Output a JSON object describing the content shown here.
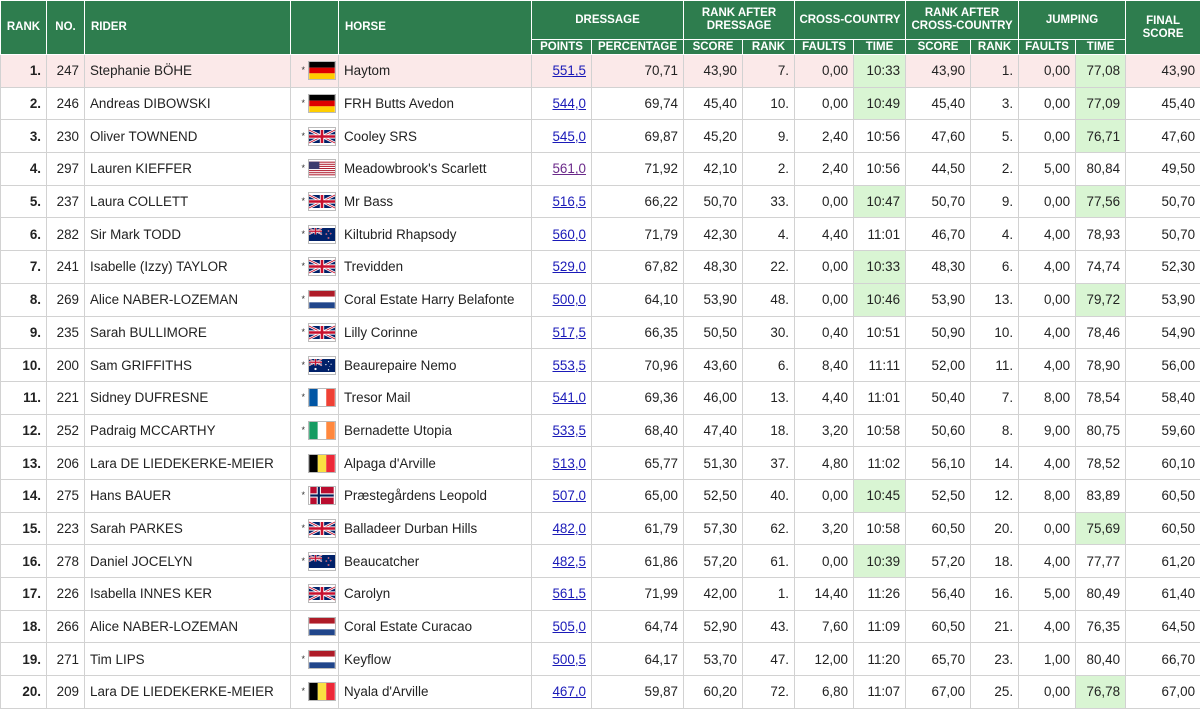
{
  "headers": {
    "rank": "RANK",
    "no": "NO.",
    "rider": "RIDER",
    "horse": "HORSE",
    "dressage": "DRESSAGE",
    "rank_after_dressage": "RANK AFTER DRESSAGE",
    "cross_country": "CROSS-COUNTRY",
    "rank_after_cross_country": "RANK AFTER CROSS-COUNTRY",
    "jumping": "JUMPING",
    "final_score": "FINAL SCORE",
    "points": "POINTS",
    "percentage": "PERCENTAGE",
    "score": "SCORE",
    "rank_sub": "RANK",
    "faults": "FAULTS",
    "time": "TIME"
  },
  "rows": [
    {
      "rank": "1.",
      "no": "247",
      "rider": "Stephanie BÖHE",
      "star": true,
      "flag": "de",
      "horse": "Haytom",
      "points": "551,5",
      "pct": "70,71",
      "rad_score": "43,90",
      "rad_rank": "7.",
      "xc_faults": "0,00",
      "xc_time": "10:33",
      "xc_time_hl": true,
      "raxc_score": "43,90",
      "raxc_rank": "1.",
      "jp_faults": "0,00",
      "jp_time": "77,08",
      "jp_time_hl": true,
      "final": "43,90"
    },
    {
      "rank": "2.",
      "no": "246",
      "rider": "Andreas DIBOWSKI",
      "star": true,
      "flag": "de",
      "horse": "FRH Butts Avedon",
      "points": "544,0",
      "pct": "69,74",
      "rad_score": "45,40",
      "rad_rank": "10.",
      "xc_faults": "0,00",
      "xc_time": "10:49",
      "xc_time_hl": true,
      "raxc_score": "45,40",
      "raxc_rank": "3.",
      "jp_faults": "0,00",
      "jp_time": "77,09",
      "jp_time_hl": true,
      "final": "45,40"
    },
    {
      "rank": "3.",
      "no": "230",
      "rider": "Oliver TOWNEND",
      "star": true,
      "flag": "gb",
      "horse": "Cooley SRS",
      "points": "545,0",
      "pct": "69,87",
      "rad_score": "45,20",
      "rad_rank": "9.",
      "xc_faults": "2,40",
      "xc_time": "10:56",
      "xc_time_hl": false,
      "raxc_score": "47,60",
      "raxc_rank": "5.",
      "jp_faults": "0,00",
      "jp_time": "76,71",
      "jp_time_hl": true,
      "final": "47,60"
    },
    {
      "rank": "4.",
      "no": "297",
      "rider": "Lauren KIEFFER",
      "star": true,
      "flag": "us",
      "horse": "Meadowbrook's Scarlett",
      "points": "561,0",
      "visited": true,
      "pct": "71,92",
      "rad_score": "42,10",
      "rad_rank": "2.",
      "xc_faults": "2,40",
      "xc_time": "10:56",
      "xc_time_hl": false,
      "raxc_score": "44,50",
      "raxc_rank": "2.",
      "jp_faults": "5,00",
      "jp_time": "80,84",
      "jp_time_hl": false,
      "final": "49,50"
    },
    {
      "rank": "5.",
      "no": "237",
      "rider": "Laura COLLETT",
      "star": true,
      "flag": "gb",
      "horse": "Mr Bass",
      "points": "516,5",
      "pct": "66,22",
      "rad_score": "50,70",
      "rad_rank": "33.",
      "xc_faults": "0,00",
      "xc_time": "10:47",
      "xc_time_hl": true,
      "raxc_score": "50,70",
      "raxc_rank": "9.",
      "jp_faults": "0,00",
      "jp_time": "77,56",
      "jp_time_hl": true,
      "final": "50,70"
    },
    {
      "rank": "6.",
      "no": "282",
      "rider": "Sir Mark TODD",
      "star": true,
      "flag": "nz",
      "horse": "Kiltubrid Rhapsody",
      "points": "560,0",
      "pct": "71,79",
      "rad_score": "42,30",
      "rad_rank": "4.",
      "xc_faults": "4,40",
      "xc_time": "11:01",
      "xc_time_hl": false,
      "raxc_score": "46,70",
      "raxc_rank": "4.",
      "jp_faults": "4,00",
      "jp_time": "78,93",
      "jp_time_hl": false,
      "final": "50,70"
    },
    {
      "rank": "7.",
      "no": "241",
      "rider": "Isabelle (Izzy) TAYLOR",
      "star": true,
      "flag": "gb",
      "horse": "Trevidden",
      "points": "529,0",
      "pct": "67,82",
      "rad_score": "48,30",
      "rad_rank": "22.",
      "xc_faults": "0,00",
      "xc_time": "10:33",
      "xc_time_hl": true,
      "raxc_score": "48,30",
      "raxc_rank": "6.",
      "jp_faults": "4,00",
      "jp_time": "74,74",
      "jp_time_hl": false,
      "final": "52,30"
    },
    {
      "rank": "8.",
      "no": "269",
      "rider": "Alice NABER-LOZEMAN",
      "star": true,
      "flag": "nl",
      "horse": "Coral Estate Harry Belafonte",
      "points": "500,0",
      "pct": "64,10",
      "rad_score": "53,90",
      "rad_rank": "48.",
      "xc_faults": "0,00",
      "xc_time": "10:46",
      "xc_time_hl": true,
      "raxc_score": "53,90",
      "raxc_rank": "13.",
      "jp_faults": "0,00",
      "jp_time": "79,72",
      "jp_time_hl": true,
      "final": "53,90"
    },
    {
      "rank": "9.",
      "no": "235",
      "rider": "Sarah BULLIMORE",
      "star": true,
      "flag": "gb",
      "horse": "Lilly Corinne",
      "points": "517,5",
      "pct": "66,35",
      "rad_score": "50,50",
      "rad_rank": "30.",
      "xc_faults": "0,40",
      "xc_time": "10:51",
      "xc_time_hl": false,
      "raxc_score": "50,90",
      "raxc_rank": "10.",
      "jp_faults": "4,00",
      "jp_time": "78,46",
      "jp_time_hl": false,
      "final": "54,90"
    },
    {
      "rank": "10.",
      "no": "200",
      "rider": "Sam GRIFFITHS",
      "star": true,
      "flag": "au",
      "horse": "Beaurepaire Nemo",
      "points": "553,5",
      "pct": "70,96",
      "rad_score": "43,60",
      "rad_rank": "6.",
      "xc_faults": "8,40",
      "xc_time": "11:11",
      "xc_time_hl": false,
      "raxc_score": "52,00",
      "raxc_rank": "11.",
      "jp_faults": "4,00",
      "jp_time": "78,90",
      "jp_time_hl": false,
      "final": "56,00"
    },
    {
      "rank": "11.",
      "no": "221",
      "rider": "Sidney DUFRESNE",
      "star": true,
      "flag": "fr",
      "horse": "Tresor Mail",
      "points": "541,0",
      "pct": "69,36",
      "rad_score": "46,00",
      "rad_rank": "13.",
      "xc_faults": "4,40",
      "xc_time": "11:01",
      "xc_time_hl": false,
      "raxc_score": "50,40",
      "raxc_rank": "7.",
      "jp_faults": "8,00",
      "jp_time": "78,54",
      "jp_time_hl": false,
      "final": "58,40"
    },
    {
      "rank": "12.",
      "no": "252",
      "rider": "Padraig MCCARTHY",
      "star": true,
      "flag": "ie",
      "horse": "Bernadette Utopia",
      "points": "533,5",
      "pct": "68,40",
      "rad_score": "47,40",
      "rad_rank": "18.",
      "xc_faults": "3,20",
      "xc_time": "10:58",
      "xc_time_hl": false,
      "raxc_score": "50,60",
      "raxc_rank": "8.",
      "jp_faults": "9,00",
      "jp_time": "80,75",
      "jp_time_hl": false,
      "final": "59,60"
    },
    {
      "rank": "13.",
      "no": "206",
      "rider": "Lara DE LIEDEKERKE-MEIER",
      "star": false,
      "flag": "be",
      "horse": "Alpaga d'Arville",
      "points": "513,0",
      "pct": "65,77",
      "rad_score": "51,30",
      "rad_rank": "37.",
      "xc_faults": "4,80",
      "xc_time": "11:02",
      "xc_time_hl": false,
      "raxc_score": "56,10",
      "raxc_rank": "14.",
      "jp_faults": "4,00",
      "jp_time": "78,52",
      "jp_time_hl": false,
      "final": "60,10"
    },
    {
      "rank": "14.",
      "no": "275",
      "rider": "Hans BAUER",
      "star": true,
      "flag": "no",
      "horse": "Præstegårdens Leopold",
      "points": "507,0",
      "pct": "65,00",
      "rad_score": "52,50",
      "rad_rank": "40.",
      "xc_faults": "0,00",
      "xc_time": "10:45",
      "xc_time_hl": true,
      "raxc_score": "52,50",
      "raxc_rank": "12.",
      "jp_faults": "8,00",
      "jp_time": "83,89",
      "jp_time_hl": false,
      "final": "60,50"
    },
    {
      "rank": "15.",
      "no": "223",
      "rider": "Sarah PARKES",
      "star": true,
      "flag": "gb",
      "horse": "Balladeer Durban Hills",
      "points": "482,0",
      "pct": "61,79",
      "rad_score": "57,30",
      "rad_rank": "62.",
      "xc_faults": "3,20",
      "xc_time": "10:58",
      "xc_time_hl": false,
      "raxc_score": "60,50",
      "raxc_rank": "20.",
      "jp_faults": "0,00",
      "jp_time": "75,69",
      "jp_time_hl": true,
      "final": "60,50"
    },
    {
      "rank": "16.",
      "no": "278",
      "rider": "Daniel JOCELYN",
      "star": true,
      "flag": "nz",
      "horse": "Beaucatcher",
      "points": "482,5",
      "pct": "61,86",
      "rad_score": "57,20",
      "rad_rank": "61.",
      "xc_faults": "0,00",
      "xc_time": "10:39",
      "xc_time_hl": true,
      "raxc_score": "57,20",
      "raxc_rank": "18.",
      "jp_faults": "4,00",
      "jp_time": "77,77",
      "jp_time_hl": false,
      "final": "61,20"
    },
    {
      "rank": "17.",
      "no": "226",
      "rider": "Isabella INNES KER",
      "star": false,
      "flag": "gb",
      "horse": "Carolyn",
      "points": "561,5",
      "pct": "71,99",
      "rad_score": "42,00",
      "rad_rank": "1.",
      "xc_faults": "14,40",
      "xc_time": "11:26",
      "xc_time_hl": false,
      "raxc_score": "56,40",
      "raxc_rank": "16.",
      "jp_faults": "5,00",
      "jp_time": "80,49",
      "jp_time_hl": false,
      "final": "61,40"
    },
    {
      "rank": "18.",
      "no": "266",
      "rider": "Alice NABER-LOZEMAN",
      "star": false,
      "flag": "nl",
      "horse": "Coral Estate Curacao",
      "points": "505,0",
      "pct": "64,74",
      "rad_score": "52,90",
      "rad_rank": "43.",
      "xc_faults": "7,60",
      "xc_time": "11:09",
      "xc_time_hl": false,
      "raxc_score": "60,50",
      "raxc_rank": "21.",
      "jp_faults": "4,00",
      "jp_time": "76,35",
      "jp_time_hl": false,
      "final": "64,50"
    },
    {
      "rank": "19.",
      "no": "271",
      "rider": "Tim LIPS",
      "star": true,
      "flag": "nl",
      "horse": "Keyflow",
      "points": "500,5",
      "pct": "64,17",
      "rad_score": "53,70",
      "rad_rank": "47.",
      "xc_faults": "12,00",
      "xc_time": "11:20",
      "xc_time_hl": false,
      "raxc_score": "65,70",
      "raxc_rank": "23.",
      "jp_faults": "1,00",
      "jp_time": "80,40",
      "jp_time_hl": false,
      "final": "66,70"
    },
    {
      "rank": "20.",
      "no": "209",
      "rider": "Lara DE LIEDEKERKE-MEIER",
      "star": true,
      "flag": "be",
      "horse": "Nyala d'Arville",
      "points": "467,0",
      "pct": "59,87",
      "rad_score": "60,20",
      "rad_rank": "72.",
      "xc_faults": "6,80",
      "xc_time": "11:07",
      "xc_time_hl": false,
      "raxc_score": "67,00",
      "raxc_rank": "25.",
      "jp_faults": "0,00",
      "jp_time": "76,78",
      "jp_time_hl": true,
      "final": "67,00"
    }
  ],
  "flag_icons": {
    "de": "germany-flag-icon",
    "gb": "united-kingdom-flag-icon",
    "us": "united-states-flag-icon",
    "nz": "new-zealand-flag-icon",
    "nl": "netherlands-flag-icon",
    "au": "australia-flag-icon",
    "fr": "france-flag-icon",
    "ie": "ireland-flag-icon",
    "be": "belgium-flag-icon",
    "no": "norway-flag-icon"
  },
  "colors": {
    "header_bg": "#2e7d4e",
    "highlight": "#d9f5d3",
    "first_row_bg": "#fbe9e9",
    "link": "#1a1ab8"
  }
}
